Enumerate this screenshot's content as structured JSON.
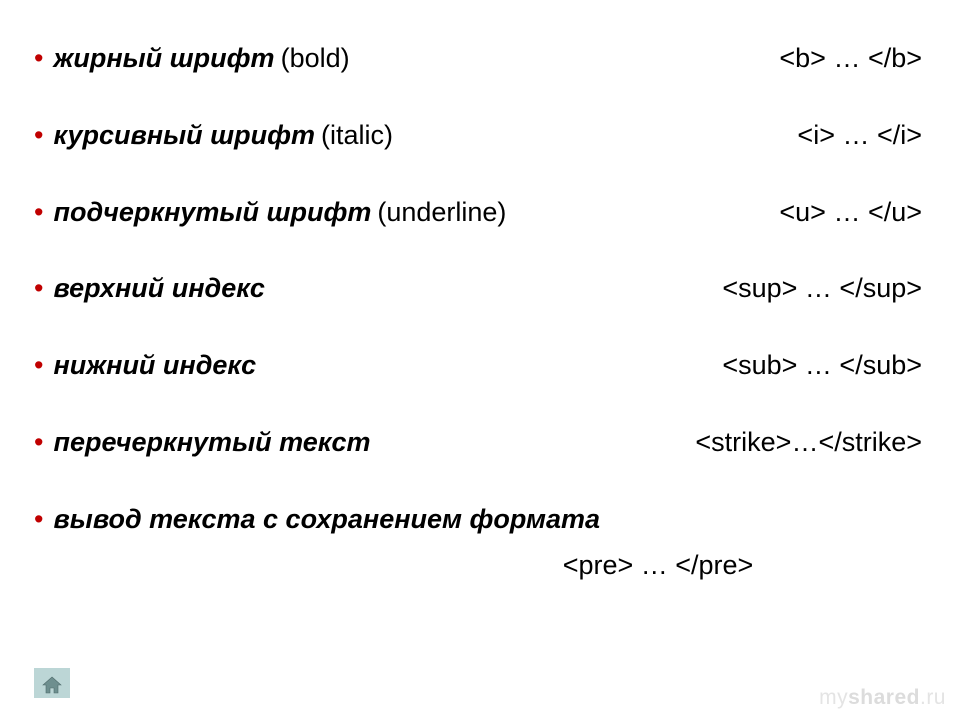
{
  "items": [
    {
      "label_ru": "жирный шрифт",
      "paren": "(bold)",
      "code": "<b> … </b>"
    },
    {
      "label_ru": "курсивный шрифт",
      "paren": "(italic)",
      "code": "<i> … </i>"
    },
    {
      "label_ru": "подчеркнутый шрифт",
      "paren": "(underline)",
      "code": "<u> … </u>"
    },
    {
      "label_ru": "верхний индекс",
      "paren": "",
      "code": "<sup> … </sup>"
    },
    {
      "label_ru": "нижний индекс",
      "paren": "",
      "code": "<sub> … </sub>"
    },
    {
      "label_ru": "перечеркнутый текст",
      "paren": "",
      "code": "<strike>…</strike>"
    },
    {
      "label_ru": "вывод текста с сохранением формата",
      "paren": "",
      "code": ""
    }
  ],
  "pre_code": "<pre> … </pre>",
  "bullet_glyph": "•",
  "bullet_color": "#c00000",
  "watermark": {
    "part1": "my",
    "part2": "shared",
    "part3": ".ru"
  },
  "home_button": {
    "name": "home-icon"
  }
}
